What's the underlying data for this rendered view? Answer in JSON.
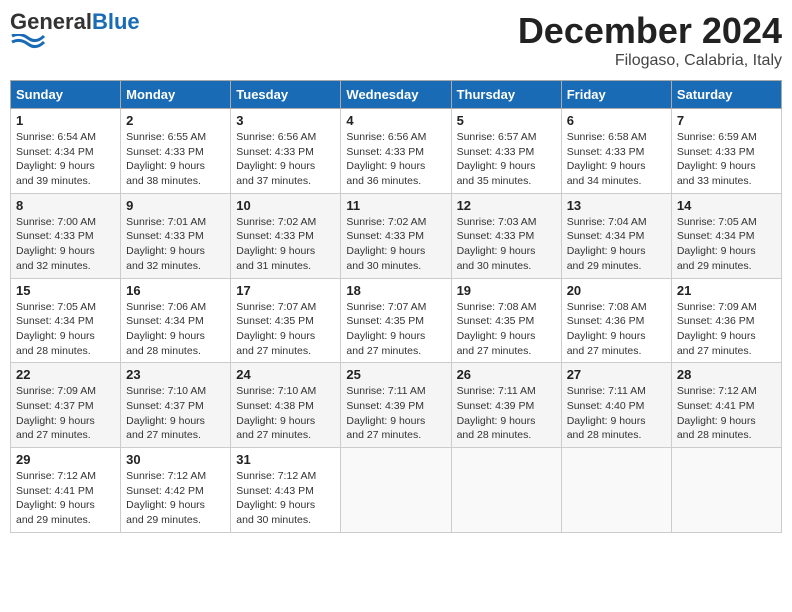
{
  "header": {
    "logo_general": "General",
    "logo_blue": "Blue",
    "month_title": "December 2024",
    "location": "Filogaso, Calabria, Italy"
  },
  "weekdays": [
    "Sunday",
    "Monday",
    "Tuesday",
    "Wednesday",
    "Thursday",
    "Friday",
    "Saturday"
  ],
  "weeks": [
    [
      {
        "day": "1",
        "sunrise": "6:54 AM",
        "sunset": "4:34 PM",
        "daylight": "9 hours and 39 minutes."
      },
      {
        "day": "2",
        "sunrise": "6:55 AM",
        "sunset": "4:33 PM",
        "daylight": "9 hours and 38 minutes."
      },
      {
        "day": "3",
        "sunrise": "6:56 AM",
        "sunset": "4:33 PM",
        "daylight": "9 hours and 37 minutes."
      },
      {
        "day": "4",
        "sunrise": "6:56 AM",
        "sunset": "4:33 PM",
        "daylight": "9 hours and 36 minutes."
      },
      {
        "day": "5",
        "sunrise": "6:57 AM",
        "sunset": "4:33 PM",
        "daylight": "9 hours and 35 minutes."
      },
      {
        "day": "6",
        "sunrise": "6:58 AM",
        "sunset": "4:33 PM",
        "daylight": "9 hours and 34 minutes."
      },
      {
        "day": "7",
        "sunrise": "6:59 AM",
        "sunset": "4:33 PM",
        "daylight": "9 hours and 33 minutes."
      }
    ],
    [
      {
        "day": "8",
        "sunrise": "7:00 AM",
        "sunset": "4:33 PM",
        "daylight": "9 hours and 32 minutes."
      },
      {
        "day": "9",
        "sunrise": "7:01 AM",
        "sunset": "4:33 PM",
        "daylight": "9 hours and 32 minutes."
      },
      {
        "day": "10",
        "sunrise": "7:02 AM",
        "sunset": "4:33 PM",
        "daylight": "9 hours and 31 minutes."
      },
      {
        "day": "11",
        "sunrise": "7:02 AM",
        "sunset": "4:33 PM",
        "daylight": "9 hours and 30 minutes."
      },
      {
        "day": "12",
        "sunrise": "7:03 AM",
        "sunset": "4:33 PM",
        "daylight": "9 hours and 30 minutes."
      },
      {
        "day": "13",
        "sunrise": "7:04 AM",
        "sunset": "4:34 PM",
        "daylight": "9 hours and 29 minutes."
      },
      {
        "day": "14",
        "sunrise": "7:05 AM",
        "sunset": "4:34 PM",
        "daylight": "9 hours and 29 minutes."
      }
    ],
    [
      {
        "day": "15",
        "sunrise": "7:05 AM",
        "sunset": "4:34 PM",
        "daylight": "9 hours and 28 minutes."
      },
      {
        "day": "16",
        "sunrise": "7:06 AM",
        "sunset": "4:34 PM",
        "daylight": "9 hours and 28 minutes."
      },
      {
        "day": "17",
        "sunrise": "7:07 AM",
        "sunset": "4:35 PM",
        "daylight": "9 hours and 27 minutes."
      },
      {
        "day": "18",
        "sunrise": "7:07 AM",
        "sunset": "4:35 PM",
        "daylight": "9 hours and 27 minutes."
      },
      {
        "day": "19",
        "sunrise": "7:08 AM",
        "sunset": "4:35 PM",
        "daylight": "9 hours and 27 minutes."
      },
      {
        "day": "20",
        "sunrise": "7:08 AM",
        "sunset": "4:36 PM",
        "daylight": "9 hours and 27 minutes."
      },
      {
        "day": "21",
        "sunrise": "7:09 AM",
        "sunset": "4:36 PM",
        "daylight": "9 hours and 27 minutes."
      }
    ],
    [
      {
        "day": "22",
        "sunrise": "7:09 AM",
        "sunset": "4:37 PM",
        "daylight": "9 hours and 27 minutes."
      },
      {
        "day": "23",
        "sunrise": "7:10 AM",
        "sunset": "4:37 PM",
        "daylight": "9 hours and 27 minutes."
      },
      {
        "day": "24",
        "sunrise": "7:10 AM",
        "sunset": "4:38 PM",
        "daylight": "9 hours and 27 minutes."
      },
      {
        "day": "25",
        "sunrise": "7:11 AM",
        "sunset": "4:39 PM",
        "daylight": "9 hours and 27 minutes."
      },
      {
        "day": "26",
        "sunrise": "7:11 AM",
        "sunset": "4:39 PM",
        "daylight": "9 hours and 28 minutes."
      },
      {
        "day": "27",
        "sunrise": "7:11 AM",
        "sunset": "4:40 PM",
        "daylight": "9 hours and 28 minutes."
      },
      {
        "day": "28",
        "sunrise": "7:12 AM",
        "sunset": "4:41 PM",
        "daylight": "9 hours and 28 minutes."
      }
    ],
    [
      {
        "day": "29",
        "sunrise": "7:12 AM",
        "sunset": "4:41 PM",
        "daylight": "9 hours and 29 minutes."
      },
      {
        "day": "30",
        "sunrise": "7:12 AM",
        "sunset": "4:42 PM",
        "daylight": "9 hours and 29 minutes."
      },
      {
        "day": "31",
        "sunrise": "7:12 AM",
        "sunset": "4:43 PM",
        "daylight": "9 hours and 30 minutes."
      },
      null,
      null,
      null,
      null
    ]
  ],
  "labels": {
    "sunrise": "Sunrise:",
    "sunset": "Sunset:",
    "daylight": "Daylight:"
  }
}
